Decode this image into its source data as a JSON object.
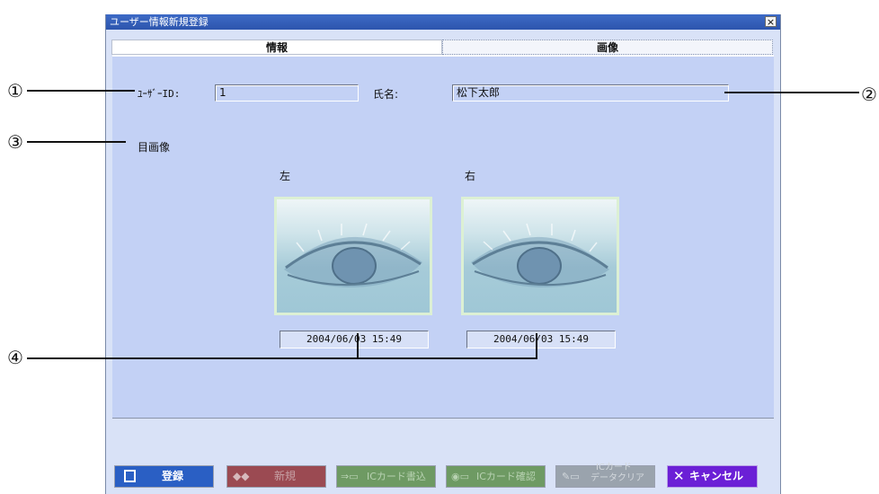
{
  "window": {
    "title": "ユーザー情報新規登録",
    "close_label": "×"
  },
  "tabs": [
    {
      "label": "情報"
    },
    {
      "label": "画像"
    }
  ],
  "form": {
    "user_id_label": "ﾕｰｻﾞｰID:",
    "user_id_value": "1",
    "name_label": "氏名:",
    "name_value": "松下太郎",
    "eye_image_label": "目画像",
    "left_label": "左",
    "right_label": "右",
    "left_date": "2004/06/03 15:49",
    "right_date": "2004/06/03 15:49"
  },
  "buttons": {
    "register": "登録",
    "new": "新規",
    "ic_write": "ICカード書込",
    "ic_confirm": "ICカード確認",
    "ic_clear_line1": "ICカード",
    "ic_clear_line2": "データクリア",
    "cancel": "キャンセル"
  },
  "colors": {
    "panel": "#c3d1f5",
    "register_button": "#2a5fc4",
    "cancel_button": "#6b1fd6",
    "disabled_new": "#9b4a52",
    "disabled_ic": "#6e9a63",
    "disabled_ic_clear": "#9aa3ad"
  },
  "annotations": {
    "c1": "①",
    "c2": "②",
    "c3": "③",
    "c4": "④"
  }
}
